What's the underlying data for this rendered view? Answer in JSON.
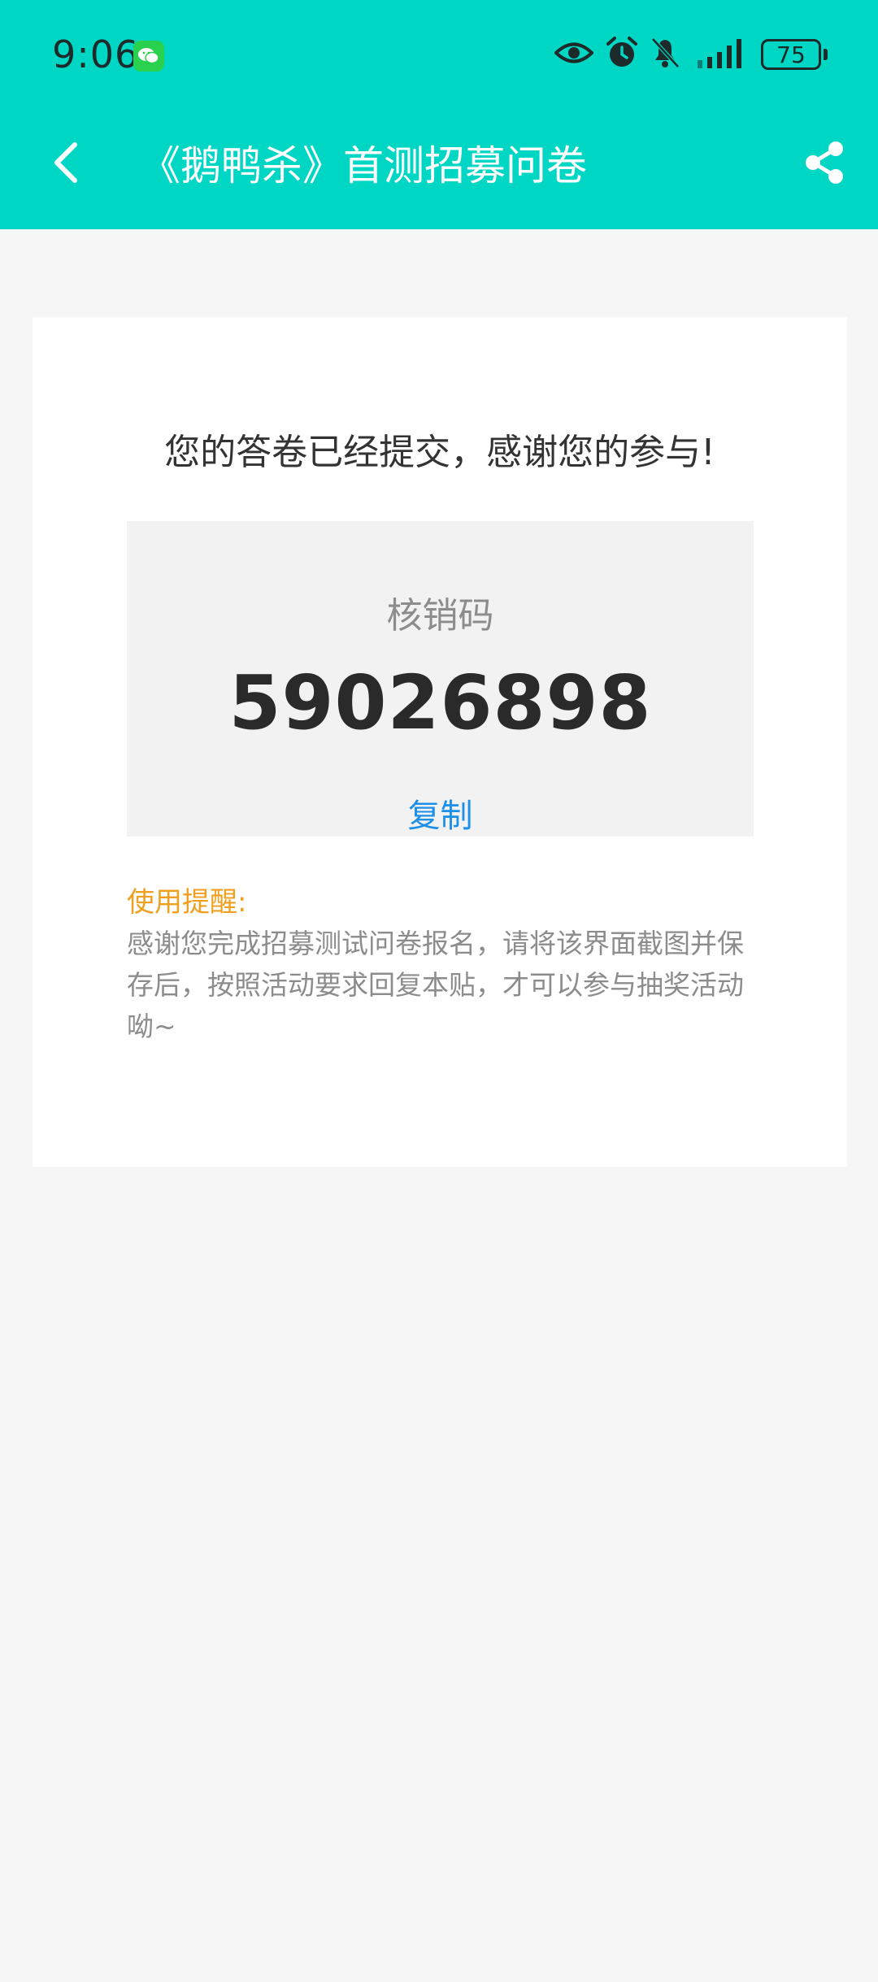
{
  "status_bar": {
    "time": "9:06",
    "battery": "75",
    "icons": [
      "wechat-icon",
      "eye-icon",
      "alarm-icon",
      "bell-muted-icon",
      "signal-icon",
      "battery-icon"
    ]
  },
  "app_bar": {
    "title": "《鹅鸭杀》首测招募问卷",
    "back_icon": "chevron-left-icon",
    "share_icon": "share-icon",
    "background_color": "#00d6c4"
  },
  "result": {
    "message": "您的答卷已经提交，感谢您的参与!",
    "code_label": "核销码",
    "code_value": "59026898",
    "copy_label": "复制"
  },
  "reminder": {
    "title": "使用提醒:",
    "text": "感谢您完成招募测试问卷报名，请将该界面截图并保存后，按照活动要求回复本贴，才可以参与抽奖活动呦~"
  },
  "colors": {
    "accent": "#00d6c4",
    "link": "#1d8fe8",
    "warning": "#f0a020"
  }
}
